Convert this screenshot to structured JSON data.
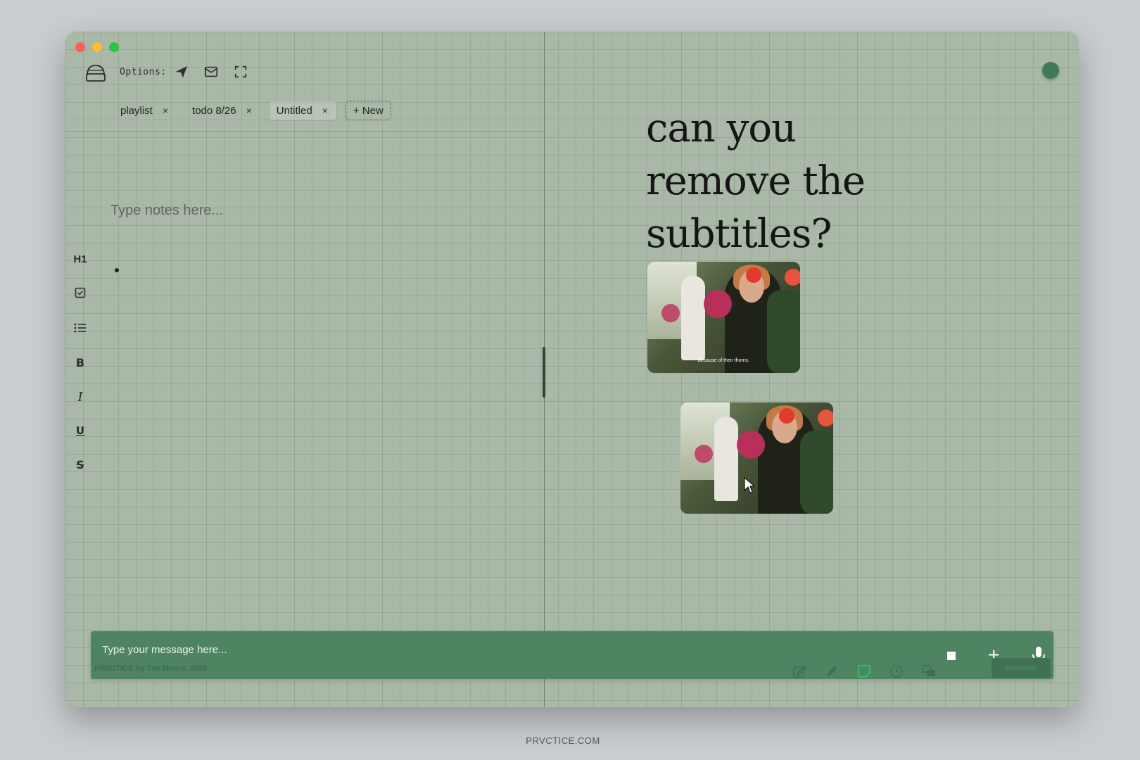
{
  "toolbar": {
    "options_label": "Options:"
  },
  "tabs": [
    {
      "label": "playlist",
      "close": "×"
    },
    {
      "label": "todo 8/26",
      "close": "×"
    },
    {
      "label": "Untitled",
      "close": "×"
    }
  ],
  "new_tab_label": "+ New",
  "editor": {
    "placeholder": "Type notes here...",
    "format_buttons": [
      "H1",
      "B",
      "I",
      "U",
      "S"
    ]
  },
  "question": "can you remove the subtitles?",
  "images": {
    "original_subtitle": "because of their thorns."
  },
  "chat": {
    "placeholder": "Type your message here...",
    "credit": "PRVCTICE by Tim Moore, 2025",
    "shortcuts_label": "Shortcuts"
  },
  "footer": "PRVCTICE.COM",
  "colors": {
    "grid_bg": "#a9b8a7",
    "chat_bar": "#4e8462",
    "status_dot": "#3e7a58"
  }
}
